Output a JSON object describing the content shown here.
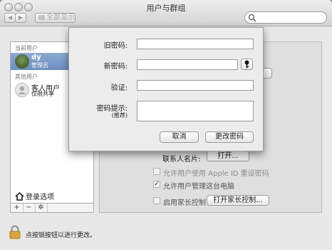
{
  "window": {
    "title": "用户与群组"
  },
  "toolbar": {
    "show_all": "全部显示",
    "search_placeholder": ""
  },
  "sidebar": {
    "current_users_header": "当前用户",
    "current_user": {
      "name": "dy",
      "role": "管理员"
    },
    "other_users_header": "其他用户",
    "guest_user": {
      "name": "客人用户",
      "role": "仅限共享"
    },
    "login_options": "登录选项",
    "add": "+",
    "remove": "−",
    "settings": "✲"
  },
  "panel": {
    "contacts_label": "联系人名片:",
    "open_button": "打开...",
    "reset_with_appleid": "允许用户使用 Apple ID 重设密码",
    "allow_admin": "允许用户管理这台电脑",
    "parental_controls": "启用家长控制",
    "open_parental_controls": "打开家长控制...",
    "checks": {
      "reset_with_appleid": false,
      "allow_admin": true,
      "parental_controls": false
    }
  },
  "lock": {
    "text": "点按锁按钮以进行更改。"
  },
  "dialog": {
    "old_password_label": "旧密码:",
    "new_password_label": "新密码:",
    "verify_label": "验证:",
    "hint_label": "密码提示:",
    "hint_sub": "(推荐)",
    "cancel": "取消",
    "change": "更改密码"
  }
}
